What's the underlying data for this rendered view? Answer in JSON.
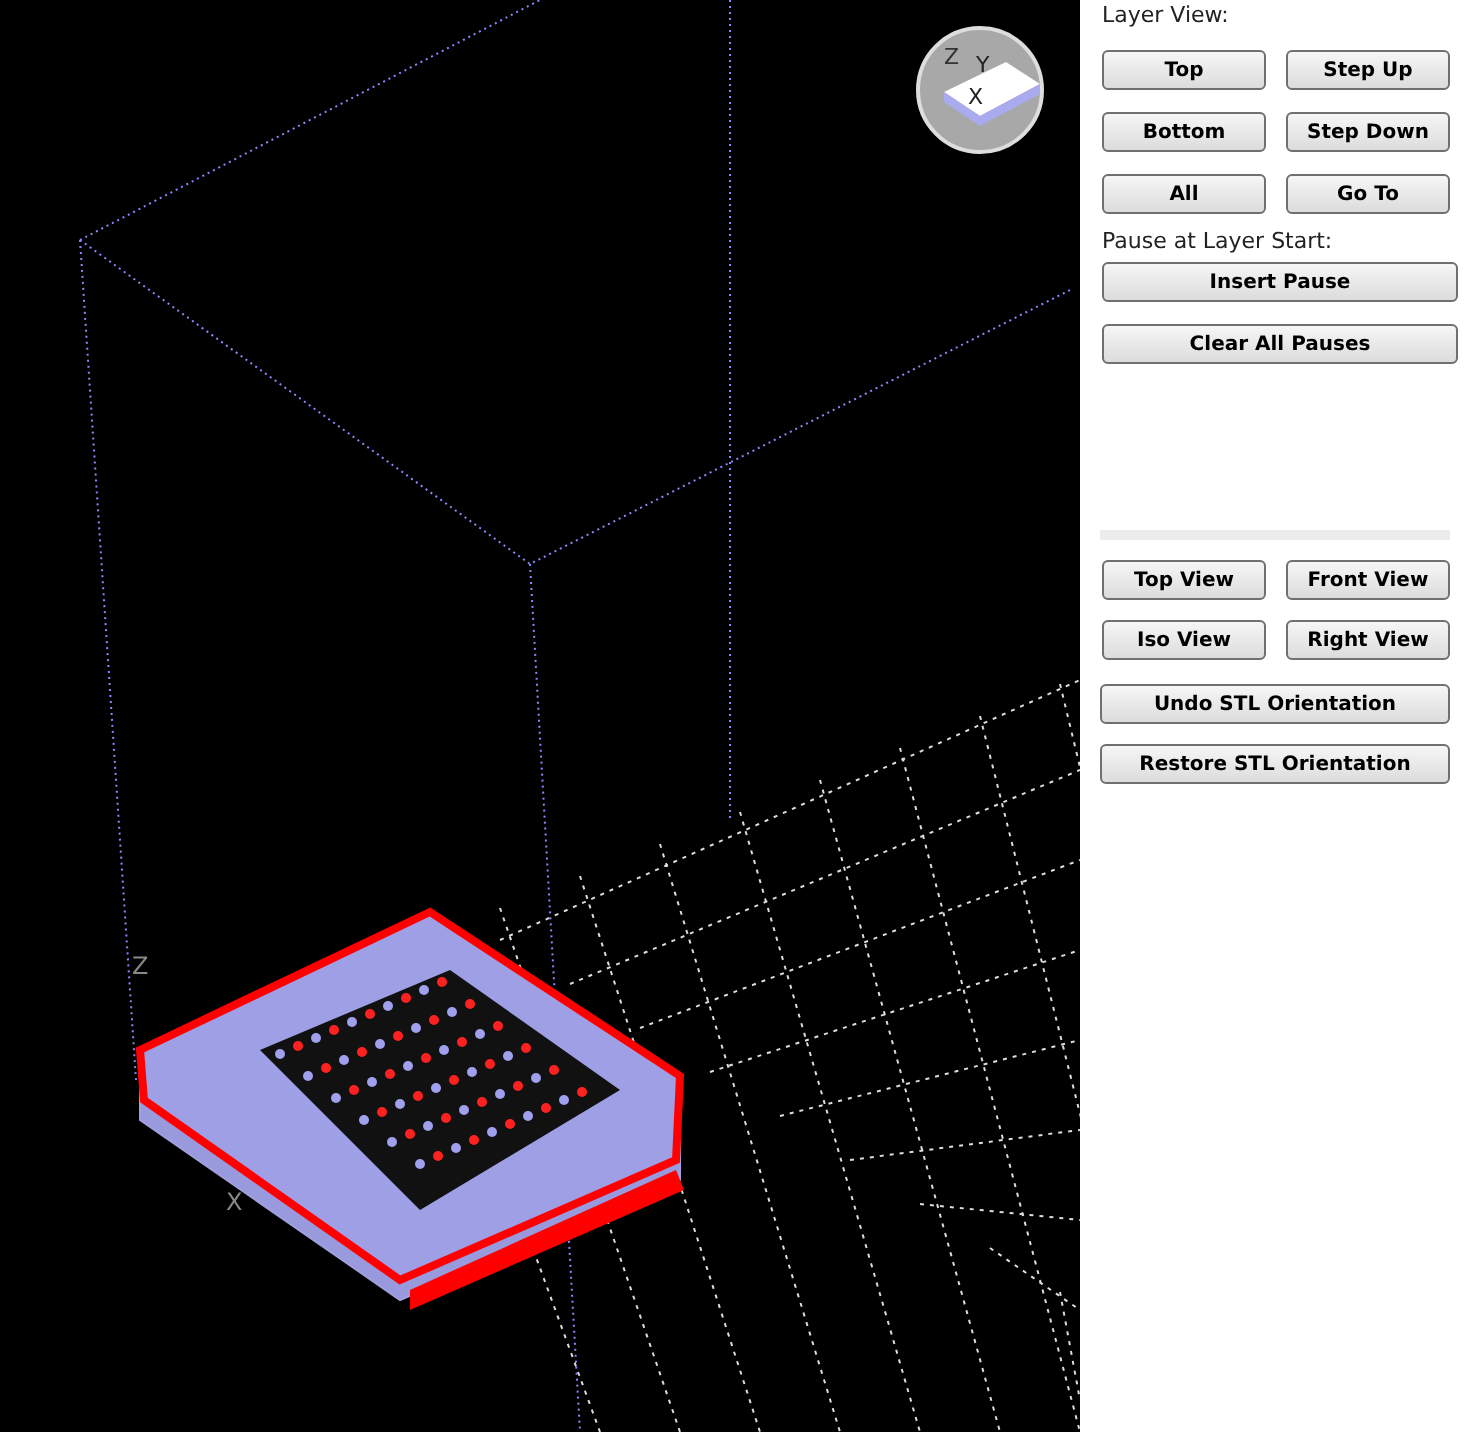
{
  "viewport": {
    "axis_labels": [
      "Z",
      "X"
    ],
    "gizmo_labels": [
      "Z",
      "Y",
      "X"
    ]
  },
  "layer_view": {
    "label": "Layer View:",
    "buttons": [
      "Top",
      "Step Up",
      "Bottom",
      "Step Down",
      "All",
      "Go To"
    ]
  },
  "pause": {
    "label": "Pause at Layer Start:",
    "buttons": [
      "Insert Pause",
      "Clear All Pauses"
    ]
  },
  "view_buttons": [
    "Top View",
    "Front View",
    "Iso View",
    "Right View"
  ],
  "orientation_buttons": [
    "Undo STL Orientation",
    "Restore STL Orientation"
  ]
}
